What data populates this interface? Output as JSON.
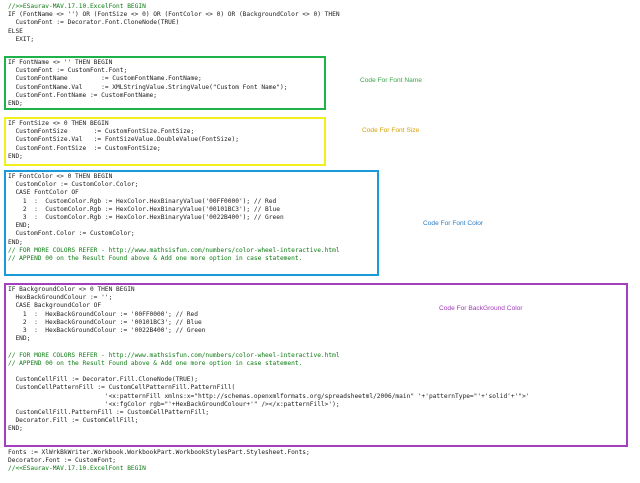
{
  "colors": {
    "green_box": "#1fb24a",
    "yellow_box": "#f2ef1b",
    "blue_box": "#1a9ad6",
    "purple_box": "#a43fbf",
    "green_label": "#3aa64a",
    "yellow_label": "#d8a000",
    "blue_label": "#2c7cc0",
    "purple_label": "#a03cb8"
  },
  "labels": {
    "font_name": "Code For Font Name",
    "font_size": "Code For Font Size",
    "font_color": "Code For Font Color",
    "background_color": "Code For BackGround Color"
  },
  "code": {
    "header": [
      "//>>ESaurav-MAV.17.10.ExcelFont BEGIN",
      "IF (FontName <> '') OR (FontSize <> 0) OR (FontColor <> 0) OR (BackgroundColor <> 0) THEN",
      "  CustomFont := Decorator.Font.CloneNode(TRUE)",
      "ELSE",
      "  EXIT;"
    ],
    "font_name": [
      "IF FontName <> '' THEN BEGIN",
      "  CustomFont := CustomFont.Font;",
      "  CustomFontName         := CustomFontName.FontName;",
      "  CustomFontName.Val     := XMLStringValue.StringValue(\"Custom Font Name\");",
      "  CustomFont.FontName := CustomFontName;",
      "END;"
    ],
    "font_size": [
      "IF FontSize <> 0 THEN BEGIN",
      "  CustomFontSize       := CustomFontSize.FontSize;",
      "  CustomFontSize.Val   := FontSizeValue.DoubleValue(FontSize);",
      "  CustomFont.FontSize  := CustomFontSize;",
      "END;"
    ],
    "font_color": [
      "IF FontColor <> 0 THEN BEGIN",
      "  CustomColor := CustomColor.Color;",
      "  CASE FontColor OF",
      "    1  :  CustomColor.Rgb := HexColor.HexBinaryValue('00FF0000'); // Red",
      "    2  :  CustomColor.Rgb := HexColor.HexBinaryValue('00101BC3'); // Blue",
      "    3  :  CustomColor.Rgb := HexColor.HexBinaryValue('0022B400'); // Green",
      "  END;",
      "  CustomFont.Color := CustomColor;",
      "END;",
      "// FOR MORE COLORS REFER - http://www.mathsisfun.com/numbers/color-wheel-interactive.html",
      "// APPEND 00 on the Result Found above & Add one more option in case statement."
    ],
    "background": [
      "IF BackgroundColor <> 0 THEN BEGIN",
      "  HexBackGroundColour := '';",
      "  CASE BackgroundColor OF",
      "    1  :  HexBackGroundColour := '00FF0000'; // Red",
      "    2  :  HexBackGroundColour := '00101BC3'; // Blue",
      "    3  :  HexBackGroundColour := '0022B400'; // Green",
      "  END;",
      "",
      "// FOR MORE COLORS REFER - http://www.mathsisfun.com/numbers/color-wheel-interactive.html",
      "// APPEND 00 on the Result Found above & Add one more option in case statement.",
      "",
      "  CustomCellFill := Decorator.Fill.CloneNode(TRUE);",
      "  CustomCellPatternFill := CustomCellPatternFill.PatternFill(",
      "                          '<x:patternFill xmlns:x=\"http://schemas.openxmlformats.org/spreadsheetml/2006/main\" '+'patternType=\"'+'solid'+'\">'",
      "                          '<x:fgColor rgb=\"'+HexBackGroundColour+'\" /></x:patternFill>');",
      "  CustomCellFill.PatternFill := CustomCellPatternFill;",
      "  Decorator.Fill := CustomCellFill;",
      "END;"
    ],
    "footer": [
      "Fonts := XlWrkBkWriter.Workbook.WorkbookPart.WorkbookStylesPart.Stylesheet.Fonts;",
      "Decorator.Font := CustomFont;",
      "//<<ESaurav-MAV.17.10.ExcelFont BEGIN"
    ]
  }
}
